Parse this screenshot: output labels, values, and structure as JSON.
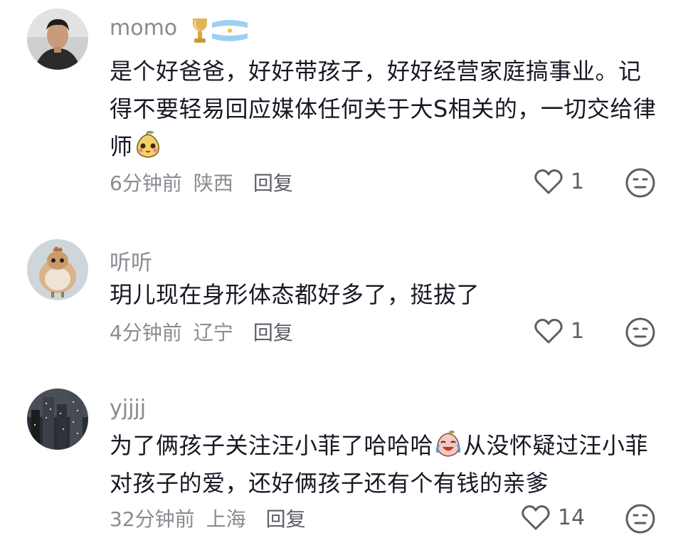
{
  "comments": [
    {
      "username": "momo",
      "text": "是个好爸爸，好好带孩子，好好经营家庭搞事业。记得不要轻易回应媒体任何关于大S相关的，一切交给律师",
      "time": "6分钟前",
      "location": "陕西",
      "reply_label": "回复",
      "likes": "1"
    },
    {
      "username": "听听",
      "text": "玥儿现在身形体态都好多了，挺拔了",
      "time": "4分钟前",
      "location": "辽宁",
      "reply_label": "回复",
      "likes": "1"
    },
    {
      "username": "yjjjj",
      "text_before_emoji": "为了俩孩子关注汪小菲了哈哈哈",
      "text_after_emoji": "从没怀疑过汪小菲对孩子的爱，还好俩孩子还有个有钱的亲爹",
      "time": "32分钟前",
      "location": "上海",
      "reply_label": "回复",
      "likes": "14"
    }
  ],
  "icons": {
    "like": "heart-outline-icon",
    "dislike": "neutral-face-icon",
    "badge": "trophy-argentina-flag-badge",
    "emoji_1": "smiling-pear-emoji",
    "emoji_2": "laughing-crying-emoji"
  },
  "colors": {
    "text": "#161823",
    "secondary": "#8a8b91",
    "icon": "#5c5e66"
  }
}
